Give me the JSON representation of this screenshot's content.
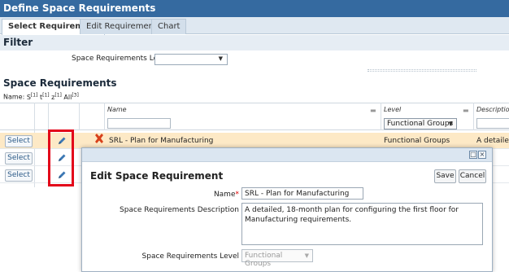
{
  "window_title": "Define Space Requirements",
  "tabs": [
    {
      "label": "Select Requirement",
      "active": true
    },
    {
      "label": "Edit Requirement",
      "active": false
    },
    {
      "label": "Chart",
      "active": false
    }
  ],
  "filter": {
    "heading": "Filter",
    "level_label": "Space Requirements Level",
    "level_value": ""
  },
  "grid": {
    "heading": "Space Requirements",
    "name_bar": {
      "label": "Name:",
      "items": [
        "S",
        "t",
        "z",
        "All"
      ],
      "counts": [
        "[1]",
        "[1]",
        "[1]",
        "[3]"
      ]
    },
    "columns": {
      "name": "Name",
      "level": "Level",
      "description": "Description"
    },
    "level_filter_value": "Functional Groups",
    "select_label": "Select",
    "rows": [
      {
        "name": "SRL - Plan for Manufacturing",
        "level": "Functional Groups",
        "description": "A detailed,"
      },
      {
        "name": "",
        "level": "",
        "description": ""
      },
      {
        "name": "",
        "level": "",
        "description": ""
      }
    ]
  },
  "dialog": {
    "title": "Edit Space Requirement",
    "save_label": "Save",
    "cancel_label": "Cancel",
    "name_label": "Name",
    "required_mark": "*",
    "name_value": "SRL - Plan for Manufacturing",
    "description_label": "Space Requirements Description",
    "description_value": "A detailed, 18-month plan for configuring the first floor for Manufacturing requirements.",
    "level_label": "Space Requirements Level",
    "level_value": "Functional Groups"
  },
  "colors": {
    "title_bar": "#356aa0",
    "highlight_box": "#e3061a",
    "selected_row": "#fde9c6"
  }
}
